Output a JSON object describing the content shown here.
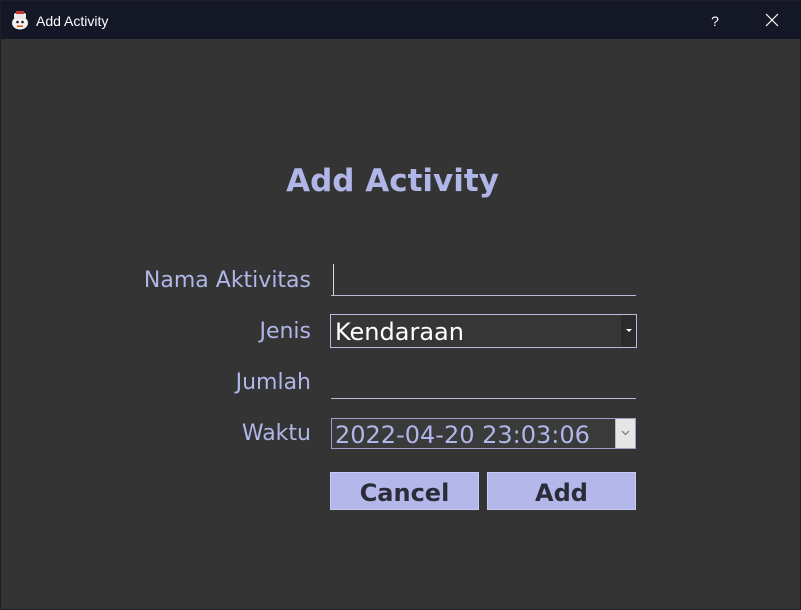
{
  "window": {
    "title": "Add Activity",
    "help_label": "?"
  },
  "form": {
    "heading": "Add Activity",
    "nama_label": "Nama Aktivitas",
    "nama_value": "",
    "jenis_label": "Jenis",
    "jenis_value": "Kendaraan",
    "jumlah_label": "Jumlah",
    "jumlah_value": "",
    "waktu_label": "Waktu",
    "waktu_value": "2022-04-20 23:03:06"
  },
  "buttons": {
    "cancel": "Cancel",
    "add": "Add"
  },
  "colors": {
    "accent": "#b0b6e8",
    "button_bg": "#b3b7ea",
    "background": "#343434",
    "titlebar": "#141826"
  }
}
